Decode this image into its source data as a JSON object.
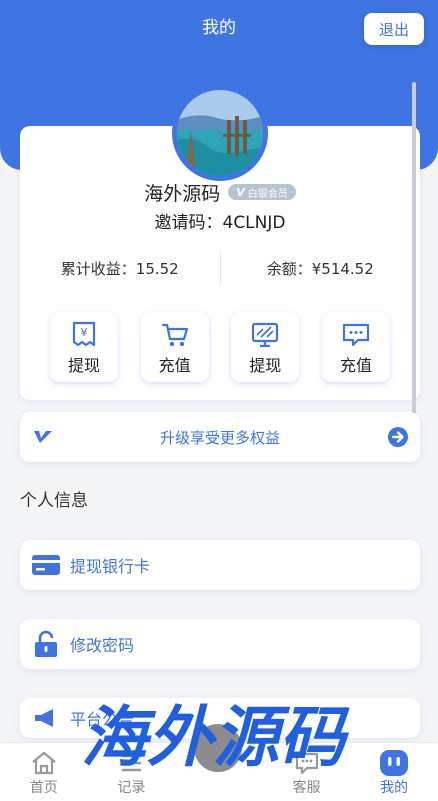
{
  "header": {
    "title": "我的",
    "logout_label": "退出"
  },
  "profile": {
    "username": "海外源码",
    "vip_level": "白银会员",
    "invite_label": "邀请码：",
    "invite_code": "4CLNJD",
    "earnings_label": "累计收益：",
    "earnings_value": "15.52",
    "balance_label": "余额：",
    "balance_value": "¥514.52"
  },
  "actions": [
    {
      "label": "提现",
      "icon": "receipt-yen-icon"
    },
    {
      "label": "充值",
      "icon": "cart-icon"
    },
    {
      "label": "提现",
      "icon": "monitor-icon"
    },
    {
      "label": "充值",
      "icon": "chat-box-icon"
    }
  ],
  "upgrade": {
    "label": "升级享受更多权益"
  },
  "section": {
    "title": "个人信息"
  },
  "menu": [
    {
      "label": "提现银行卡",
      "icon": "bank-card-icon"
    },
    {
      "label": "修改密码",
      "icon": "lock-icon"
    },
    {
      "label": "平台公告",
      "icon": "megaphone-icon"
    }
  ],
  "tabbar": [
    {
      "label": "首页",
      "icon": "home-icon"
    },
    {
      "label": "记录",
      "icon": "list-icon"
    },
    {
      "label": "",
      "icon": "center-icon"
    },
    {
      "label": "客服",
      "icon": "service-icon"
    },
    {
      "label": "我的",
      "icon": "user-icon"
    }
  ],
  "watermark": "海外源码",
  "colors": {
    "brand": "#3f74e3",
    "background": "#f4f5f7"
  }
}
